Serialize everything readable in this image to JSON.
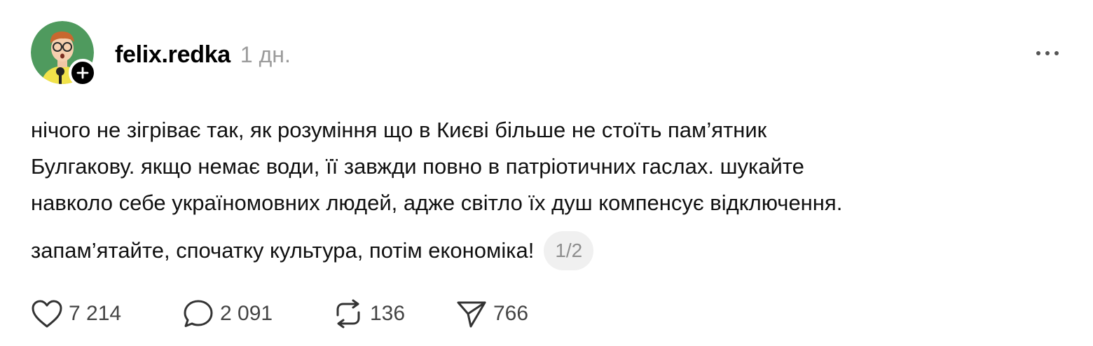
{
  "post": {
    "author": {
      "username": "felix.redka",
      "timestamp": "1 дн."
    },
    "paragraphs": [
      [
        "нічого не зігріває так, як розуміння що в Києві більше не стоїть пам’ятник",
        "Булгакову. якщо немає води, її завжди повно в патріотичних гаслах. шукайте",
        "навколо себе україномовних людей, адже світло їх душ компенсує відключення."
      ],
      "запам’ятайте, спочатку культура, потім економіка!"
    ],
    "page_indicator": "1/2"
  },
  "actions": {
    "likes": "7 214",
    "replies": "2 091",
    "reposts": "136",
    "shares": "766"
  },
  "icons": {
    "follow": "plus-icon",
    "more": "more-horizontal-icon",
    "like": "heart-icon",
    "reply": "comment-bubble-icon",
    "repost": "repost-arrows-icon",
    "share": "paper-plane-icon"
  },
  "colors": {
    "avatar_background": "#4f9a5e",
    "timestamp": "#9b9b9b",
    "page_chip_background": "#f0f0f0"
  }
}
